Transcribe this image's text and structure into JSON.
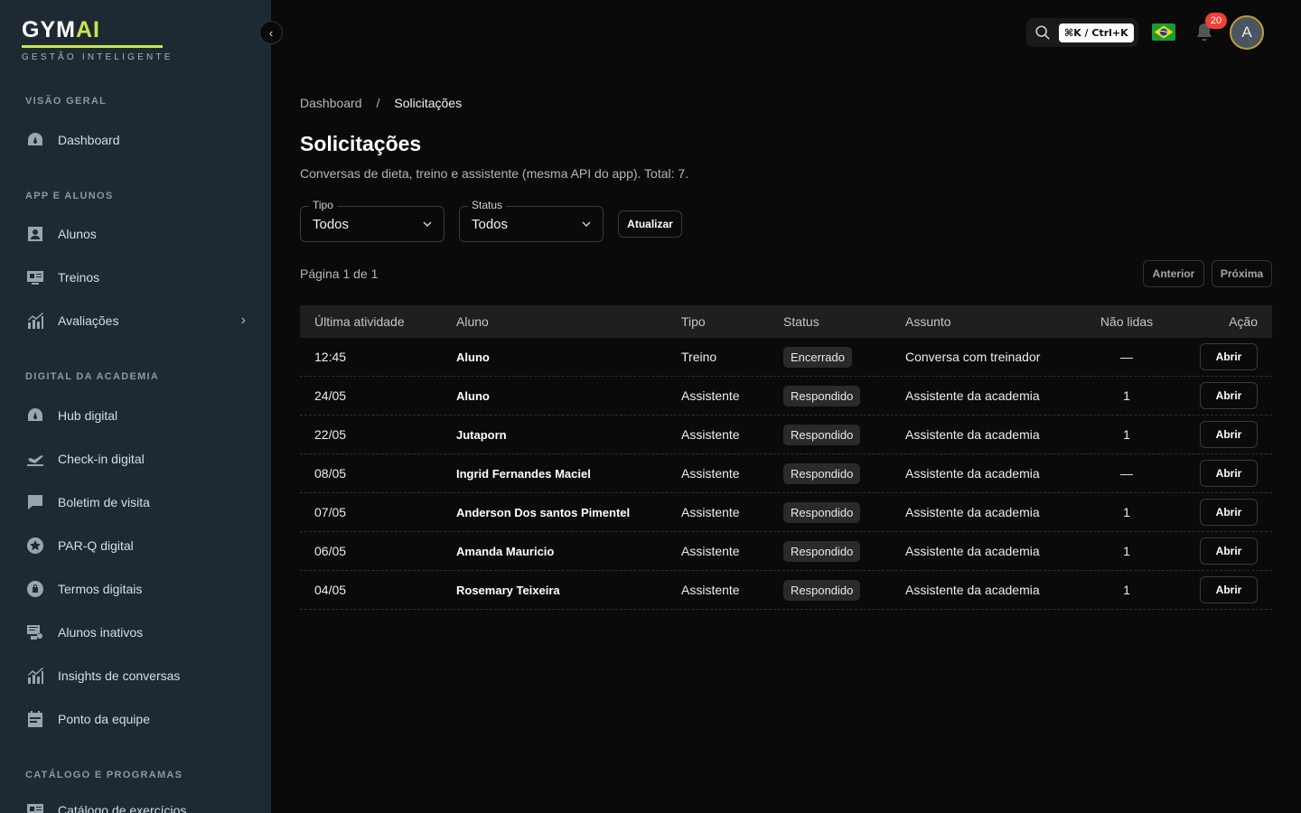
{
  "brand": {
    "name_main": "GYM",
    "name_accent": "AI",
    "tagline": "GESTÃO INTELIGENTE",
    "accent_color": "#c8e64c"
  },
  "sidebar": {
    "collapse_icon": "chevron-left-icon",
    "sections": [
      {
        "title": "VISÃO GERAL",
        "items": [
          {
            "label": "Dashboard",
            "icon": "gauge-icon"
          }
        ]
      },
      {
        "title": "APP E ALUNOS",
        "items": [
          {
            "label": "Alunos",
            "icon": "user-icon"
          },
          {
            "label": "Treinos",
            "icon": "id-card-icon"
          },
          {
            "label": "Avaliações",
            "icon": "chart-bars-icon",
            "has_children": true
          }
        ]
      },
      {
        "title": "DIGITAL DA ACADEMIA",
        "items": [
          {
            "label": "Hub digital",
            "icon": "gauge-icon"
          },
          {
            "label": "Check-in digital",
            "icon": "plane-icon"
          },
          {
            "label": "Boletim de visita",
            "icon": "message-icon"
          },
          {
            "label": "PAR-Q digital",
            "icon": "star-badge-icon"
          },
          {
            "label": "Termos digitais",
            "icon": "lock-icon"
          },
          {
            "label": "Alunos inativos",
            "icon": "user-list-icon"
          },
          {
            "label": "Insights de conversas",
            "icon": "chart-bars-icon"
          },
          {
            "label": "Ponto da equipe",
            "icon": "calendar-icon"
          }
        ]
      },
      {
        "title": "CATÁLOGO E PROGRAMAS",
        "items": [
          {
            "label": "Catálogo de exercícios",
            "icon": "id-card-icon"
          }
        ]
      }
    ]
  },
  "topbar": {
    "search_shortcut": "⌘K / Ctrl+K",
    "notifications_count": "20",
    "avatar_initial": "A"
  },
  "breadcrumb": {
    "root": "Dashboard",
    "separator": "/",
    "current": "Solicitações"
  },
  "page": {
    "title": "Solicitações",
    "description": "Conversas de dieta, treino e assistente (mesma API do app). Total: 7."
  },
  "filters": {
    "tipo": {
      "label": "Tipo",
      "value": "Todos"
    },
    "status": {
      "label": "Status",
      "value": "Todos"
    },
    "refresh_label": "Atualizar"
  },
  "pagination": {
    "text": "Página 1 de 1",
    "prev_label": "Anterior",
    "next_label": "Próxima"
  },
  "table": {
    "headers": {
      "time": "Última atividade",
      "aluno": "Aluno",
      "tipo": "Tipo",
      "status": "Status",
      "assunto": "Assunto",
      "nao_lidas": "Não lidas",
      "acao": "Ação"
    },
    "rows": [
      {
        "time": "12:45",
        "aluno": "Aluno",
        "tipo": "Treino",
        "status": "Encerrado",
        "assunto": "Conversa com treinador",
        "nao_lidas": "—",
        "acao": "Abrir"
      },
      {
        "time": "24/05",
        "aluno": "Aluno",
        "tipo": "Assistente",
        "status": "Respondido",
        "assunto": "Assistente da academia",
        "nao_lidas": "1",
        "acao": "Abrir"
      },
      {
        "time": "22/05",
        "aluno": "Jutaporn",
        "tipo": "Assistente",
        "status": "Respondido",
        "assunto": "Assistente da academia",
        "nao_lidas": "1",
        "acao": "Abrir"
      },
      {
        "time": "08/05",
        "aluno": "Ingrid Fernandes Maciel",
        "tipo": "Assistente",
        "status": "Respondido",
        "assunto": "Assistente da academia",
        "nao_lidas": "—",
        "acao": "Abrir"
      },
      {
        "time": "07/05",
        "aluno": "Anderson Dos santos Pimentel",
        "tipo": "Assistente",
        "status": "Respondido",
        "assunto": "Assistente da academia",
        "nao_lidas": "1",
        "acao": "Abrir"
      },
      {
        "time": "06/05",
        "aluno": "Amanda Mauricio",
        "tipo": "Assistente",
        "status": "Respondido",
        "assunto": "Assistente da academia",
        "nao_lidas": "1",
        "acao": "Abrir"
      },
      {
        "time": "04/05",
        "aluno": "Rosemary Teixeira",
        "tipo": "Assistente",
        "status": "Respondido",
        "assunto": "Assistente da academia",
        "nao_lidas": "1",
        "acao": "Abrir"
      }
    ]
  }
}
